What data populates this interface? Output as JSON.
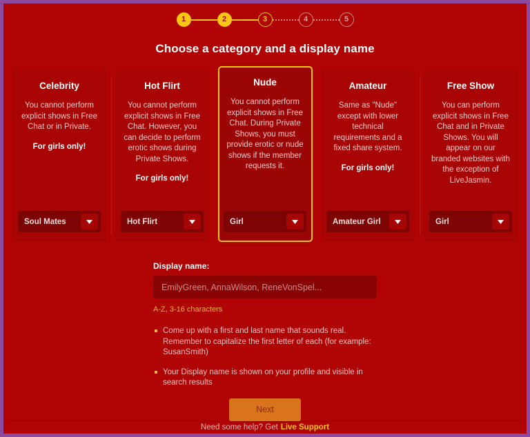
{
  "theme": {
    "page_background": "#b00404",
    "outer_border": "#8e4a9e",
    "accent_gold": "#fcc612",
    "accent_orange": "#d9731c",
    "card_background": "#a80404",
    "selected_card_background": "#9c0505"
  },
  "stepper": {
    "steps": [
      {
        "number": "1",
        "state": "done"
      },
      {
        "number": "2",
        "state": "done"
      },
      {
        "number": "3",
        "state": "current"
      },
      {
        "number": "4",
        "state": "todo"
      },
      {
        "number": "5",
        "state": "todo"
      }
    ]
  },
  "heading": "Choose a category and a display name",
  "cards": [
    {
      "title": "Celebrity",
      "description": "You cannot perform explicit shows in Free Chat or in Private.",
      "note": "For girls only!",
      "selected": false,
      "select": {
        "value": "Soul Mates",
        "icon": "chevron-down-icon"
      }
    },
    {
      "title": "Hot Flirt",
      "description": "You cannot perform explicit shows in Free Chat. However, you can decide to perform erotic shows during Private Shows.",
      "note": "For girls only!",
      "selected": false,
      "select": {
        "value": "Hot Flirt",
        "icon": "chevron-down-icon"
      }
    },
    {
      "title": "Nude",
      "description": "You cannot perform explicit shows in Free Chat. During Private Shows, you must provide erotic or nude shows if the member requests it.",
      "note": "",
      "selected": true,
      "select": {
        "value": "Girl",
        "icon": "chevron-down-icon"
      }
    },
    {
      "title": "Amateur",
      "description": "Same as \"Nude\" except with lower technical requirements and a fixed share system.",
      "note": "For girls only!",
      "selected": false,
      "select": {
        "value": "Amateur Girl",
        "icon": "chevron-down-icon"
      }
    },
    {
      "title": "Free Show",
      "description": "You can perform explicit shows in Free Chat and in Private Shows. You will appear on our branded websites with the exception of LiveJasmin.",
      "note": "",
      "selected": false,
      "select": {
        "value": "Girl",
        "icon": "chevron-down-icon"
      }
    }
  ],
  "form": {
    "label": "Display name:",
    "input_value": "",
    "placeholder": "EmilyGreen, AnnaWilson, ReneVonSpel...",
    "hint": "A-Z, 3-16 characters",
    "tips": [
      "Come up with a first and last name that sounds real. Remember to capitalize the first letter of each (for example: SusanSmith)",
      "Your Display name is shown on your profile and visible in search results"
    ],
    "next_label": "Next"
  },
  "footer": {
    "text": "Need some help? Get",
    "link": "Live Support"
  }
}
